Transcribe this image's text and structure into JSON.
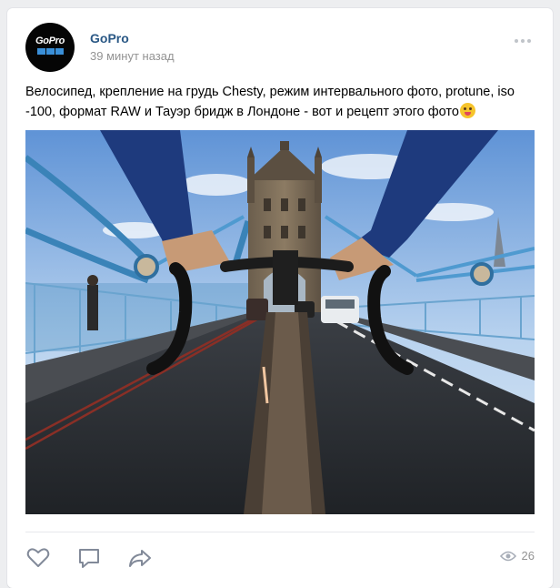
{
  "post": {
    "author": "GoPro",
    "time": "39 минут назад",
    "text": "Велосипед, крепление на грудь Chesty, режим интервального фото, protune, iso -100, формат RAW и Тауэр бридж в Лондоне - вот и рецепт этого фото",
    "avatar_logo_text": "GoPro",
    "emoji": "face-with-tongue-emoji"
  },
  "actions": {
    "like_icon": "heart-icon",
    "comment_icon": "comment-icon",
    "share_icon": "share-icon",
    "views_icon": "eye-icon",
    "views_count": "26"
  },
  "colors": {
    "link": "#2a5885",
    "muted": "#939393",
    "page_bg": "#edeef0",
    "brand_blue": "#3a8fd8"
  }
}
